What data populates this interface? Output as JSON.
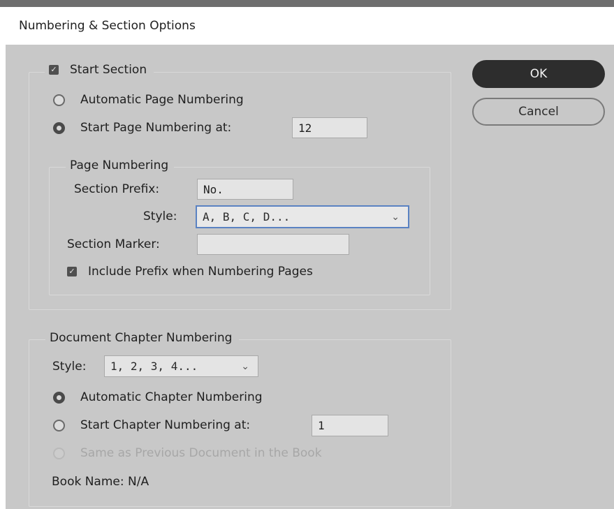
{
  "window": {
    "title": "Numbering & Section Options"
  },
  "start_section": {
    "label": "Start Section",
    "checked": true
  },
  "auto_page_numbering": {
    "label": "Automatic Page Numbering",
    "selected": false
  },
  "start_page_numbering": {
    "label": "Start Page Numbering at:",
    "selected": true,
    "value": "12"
  },
  "page_numbering": {
    "legend": "Page Numbering",
    "prefix_label": "Section Prefix:",
    "prefix_value": "No.",
    "style_label": "Style:",
    "style_value": "A, B, C, D...",
    "marker_label": "Section Marker:",
    "marker_value": "",
    "include_prefix_label": "Include Prefix when Numbering Pages",
    "include_prefix_checked": true
  },
  "chapter": {
    "legend": "Document Chapter Numbering",
    "style_label": "Style:",
    "style_value": "1, 2, 3, 4...",
    "auto_label": "Automatic Chapter Numbering",
    "start_label": "Start Chapter Numbering at:",
    "start_value": "1",
    "same_label": "Same as Previous Document in the Book",
    "book_name": "Book Name: N/A"
  },
  "buttons": {
    "ok": "OK",
    "cancel": "Cancel"
  }
}
